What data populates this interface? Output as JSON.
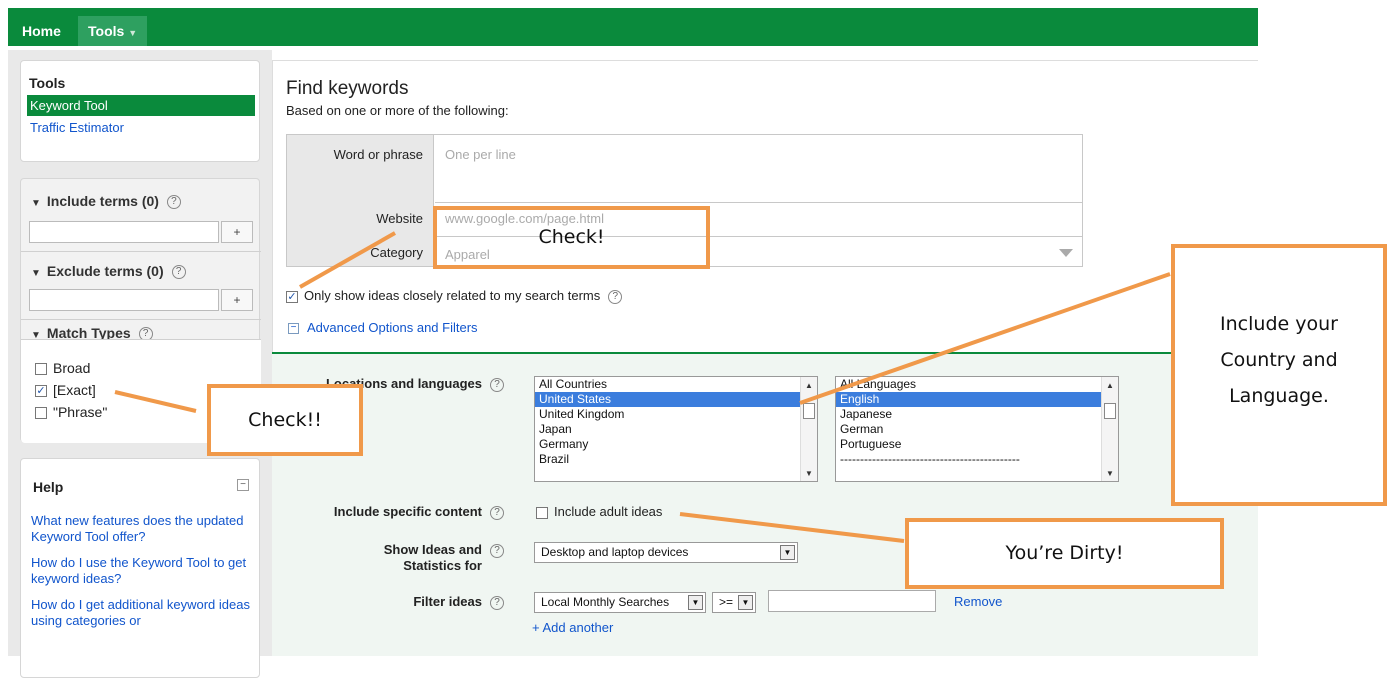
{
  "topnav": {
    "home": "Home",
    "tools": "Tools"
  },
  "sidebar": {
    "tools_title": "Tools",
    "keyword_tool": "Keyword Tool",
    "traffic_estimator": "Traffic Estimator",
    "include_terms": "Include terms (0)",
    "exclude_terms": "Exclude terms (0)",
    "plus": "+",
    "match_types": "Match Types",
    "match_options": [
      {
        "label": "Broad",
        "checked": false
      },
      {
        "label": "[Exact]",
        "checked": true
      },
      {
        "label": "\"Phrase\"",
        "checked": false
      }
    ],
    "help_title": "Help",
    "help_links": [
      "What new features does the updated Keyword Tool offer?",
      "How do I use the Keyword Tool to get keyword ideas?",
      "How do I get additional keyword ideas using categories or"
    ]
  },
  "main": {
    "title": "Find keywords",
    "subtitle": "Based on one or more of the following:",
    "word_label": "Word or phrase",
    "word_placeholder": "One per line",
    "website_label": "Website",
    "website_placeholder": "www.google.com/page.html",
    "category_label": "Category",
    "category_placeholder": "Apparel",
    "only_show": "Only show ideas closely related to my search terms",
    "advanced": "Advanced Options and Filters",
    "locations_label": "Locations and languages",
    "countries": [
      "All Countries",
      "United States",
      "United Kingdom",
      "Japan",
      "Germany",
      "Brazil"
    ],
    "selected_country": "United States",
    "languages": [
      "All Languages",
      "English",
      "Japanese",
      "German",
      "Portuguese",
      "---------------------------------------------"
    ],
    "selected_language": "English",
    "specific_label": "Include specific content",
    "adult": "Include adult ideas",
    "show_ideas_label": "Show Ideas and",
    "statistics_for": "Statistics for",
    "device_select": "Desktop and laptop devices",
    "filter_label": "Filter ideas",
    "filter_select": "Local Monthly Searches",
    "operator_select": ">=",
    "remove": "Remove",
    "add_another": "+ Add another"
  },
  "callouts": {
    "check1": "Check!",
    "check2": "Check!!",
    "country_lang": [
      "Include your",
      "Country and",
      "Language."
    ],
    "dirty": "You’re Dirty!"
  },
  "colors": {
    "brand_green": "#0a8a3c",
    "callout_orange": "#f0994a",
    "link_blue": "#1155cc",
    "selection_blue": "#3b7ddd"
  }
}
